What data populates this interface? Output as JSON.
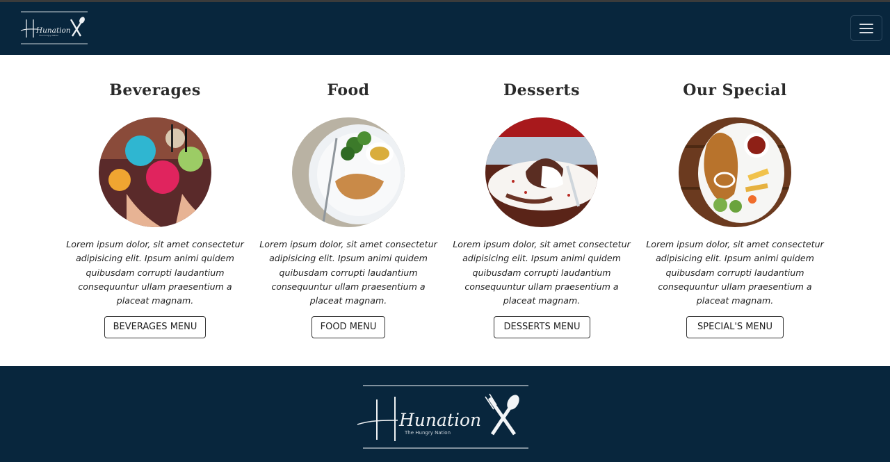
{
  "brand": {
    "name": "Hunation",
    "tagline": "The Hungry Nation"
  },
  "nav": {
    "toggle_label": "Toggle navigation"
  },
  "cards": [
    {
      "title": "Beverages",
      "text": "Lorem ipsum dolor, sit amet consectetur adipisicing elit. Ipsum animi quidem quibusdam corrupti laudantium consequuntur ullam praesentium a placeat magnam.",
      "button": "BEVERAGES MENU"
    },
    {
      "title": "Food",
      "text": "Lorem ipsum dolor, sit amet consectetur adipisicing elit. Ipsum animi quidem quibusdam corrupti laudantium consequuntur ullam praesentium a placeat magnam.",
      "button": "FOOD MENU"
    },
    {
      "title": "Desserts",
      "text": "Lorem ipsum dolor, sit amet consectetur adipisicing elit. Ipsum animi quidem quibusdam corrupti laudantium consequuntur ullam praesentium a placeat magnam.",
      "button": "DESSERTS MENU"
    },
    {
      "title": "Our Special",
      "text": "Lorem ipsum dolor, sit amet consectetur adipisicing elit. Ipsum animi quidem quibusdam corrupti laudantium consequuntur ullam praesentium a placeat magnam.",
      "button": "SPECIAL'S MENU"
    }
  ],
  "colors": {
    "navy": "#08263d",
    "text": "#222222",
    "white": "#ffffff"
  }
}
